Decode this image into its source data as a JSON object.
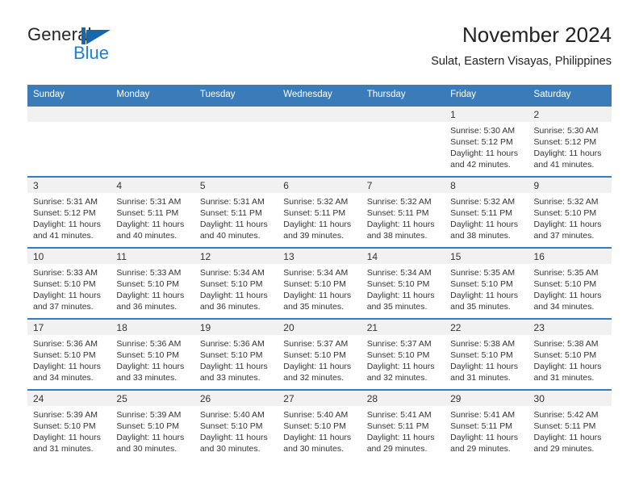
{
  "brand": {
    "name_part1": "General",
    "name_part2": "Blue",
    "mark_icon": "triangle-flag-icon"
  },
  "header": {
    "title": "November 2024",
    "subtitle": "Sulat, Eastern Visayas, Philippines"
  },
  "calendar": {
    "weekday_headers": [
      "Sunday",
      "Monday",
      "Tuesday",
      "Wednesday",
      "Thursday",
      "Friday",
      "Saturday"
    ],
    "accent_color": "#3b7cb8",
    "daynum_band_color": "#f1f1f1",
    "weeks": [
      [
        {
          "day": ""
        },
        {
          "day": ""
        },
        {
          "day": ""
        },
        {
          "day": ""
        },
        {
          "day": ""
        },
        {
          "day": "1",
          "sunrise": "Sunrise: 5:30 AM",
          "sunset": "Sunset: 5:12 PM",
          "daylight1": "Daylight: 11 hours",
          "daylight2": "and 42 minutes."
        },
        {
          "day": "2",
          "sunrise": "Sunrise: 5:30 AM",
          "sunset": "Sunset: 5:12 PM",
          "daylight1": "Daylight: 11 hours",
          "daylight2": "and 41 minutes."
        }
      ],
      [
        {
          "day": "3",
          "sunrise": "Sunrise: 5:31 AM",
          "sunset": "Sunset: 5:12 PM",
          "daylight1": "Daylight: 11 hours",
          "daylight2": "and 41 minutes."
        },
        {
          "day": "4",
          "sunrise": "Sunrise: 5:31 AM",
          "sunset": "Sunset: 5:11 PM",
          "daylight1": "Daylight: 11 hours",
          "daylight2": "and 40 minutes."
        },
        {
          "day": "5",
          "sunrise": "Sunrise: 5:31 AM",
          "sunset": "Sunset: 5:11 PM",
          "daylight1": "Daylight: 11 hours",
          "daylight2": "and 40 minutes."
        },
        {
          "day": "6",
          "sunrise": "Sunrise: 5:32 AM",
          "sunset": "Sunset: 5:11 PM",
          "daylight1": "Daylight: 11 hours",
          "daylight2": "and 39 minutes."
        },
        {
          "day": "7",
          "sunrise": "Sunrise: 5:32 AM",
          "sunset": "Sunset: 5:11 PM",
          "daylight1": "Daylight: 11 hours",
          "daylight2": "and 38 minutes."
        },
        {
          "day": "8",
          "sunrise": "Sunrise: 5:32 AM",
          "sunset": "Sunset: 5:11 PM",
          "daylight1": "Daylight: 11 hours",
          "daylight2": "and 38 minutes."
        },
        {
          "day": "9",
          "sunrise": "Sunrise: 5:32 AM",
          "sunset": "Sunset: 5:10 PM",
          "daylight1": "Daylight: 11 hours",
          "daylight2": "and 37 minutes."
        }
      ],
      [
        {
          "day": "10",
          "sunrise": "Sunrise: 5:33 AM",
          "sunset": "Sunset: 5:10 PM",
          "daylight1": "Daylight: 11 hours",
          "daylight2": "and 37 minutes."
        },
        {
          "day": "11",
          "sunrise": "Sunrise: 5:33 AM",
          "sunset": "Sunset: 5:10 PM",
          "daylight1": "Daylight: 11 hours",
          "daylight2": "and 36 minutes."
        },
        {
          "day": "12",
          "sunrise": "Sunrise: 5:34 AM",
          "sunset": "Sunset: 5:10 PM",
          "daylight1": "Daylight: 11 hours",
          "daylight2": "and 36 minutes."
        },
        {
          "day": "13",
          "sunrise": "Sunrise: 5:34 AM",
          "sunset": "Sunset: 5:10 PM",
          "daylight1": "Daylight: 11 hours",
          "daylight2": "and 35 minutes."
        },
        {
          "day": "14",
          "sunrise": "Sunrise: 5:34 AM",
          "sunset": "Sunset: 5:10 PM",
          "daylight1": "Daylight: 11 hours",
          "daylight2": "and 35 minutes."
        },
        {
          "day": "15",
          "sunrise": "Sunrise: 5:35 AM",
          "sunset": "Sunset: 5:10 PM",
          "daylight1": "Daylight: 11 hours",
          "daylight2": "and 35 minutes."
        },
        {
          "day": "16",
          "sunrise": "Sunrise: 5:35 AM",
          "sunset": "Sunset: 5:10 PM",
          "daylight1": "Daylight: 11 hours",
          "daylight2": "and 34 minutes."
        }
      ],
      [
        {
          "day": "17",
          "sunrise": "Sunrise: 5:36 AM",
          "sunset": "Sunset: 5:10 PM",
          "daylight1": "Daylight: 11 hours",
          "daylight2": "and 34 minutes."
        },
        {
          "day": "18",
          "sunrise": "Sunrise: 5:36 AM",
          "sunset": "Sunset: 5:10 PM",
          "daylight1": "Daylight: 11 hours",
          "daylight2": "and 33 minutes."
        },
        {
          "day": "19",
          "sunrise": "Sunrise: 5:36 AM",
          "sunset": "Sunset: 5:10 PM",
          "daylight1": "Daylight: 11 hours",
          "daylight2": "and 33 minutes."
        },
        {
          "day": "20",
          "sunrise": "Sunrise: 5:37 AM",
          "sunset": "Sunset: 5:10 PM",
          "daylight1": "Daylight: 11 hours",
          "daylight2": "and 32 minutes."
        },
        {
          "day": "21",
          "sunrise": "Sunrise: 5:37 AM",
          "sunset": "Sunset: 5:10 PM",
          "daylight1": "Daylight: 11 hours",
          "daylight2": "and 32 minutes."
        },
        {
          "day": "22",
          "sunrise": "Sunrise: 5:38 AM",
          "sunset": "Sunset: 5:10 PM",
          "daylight1": "Daylight: 11 hours",
          "daylight2": "and 31 minutes."
        },
        {
          "day": "23",
          "sunrise": "Sunrise: 5:38 AM",
          "sunset": "Sunset: 5:10 PM",
          "daylight1": "Daylight: 11 hours",
          "daylight2": "and 31 minutes."
        }
      ],
      [
        {
          "day": "24",
          "sunrise": "Sunrise: 5:39 AM",
          "sunset": "Sunset: 5:10 PM",
          "daylight1": "Daylight: 11 hours",
          "daylight2": "and 31 minutes."
        },
        {
          "day": "25",
          "sunrise": "Sunrise: 5:39 AM",
          "sunset": "Sunset: 5:10 PM",
          "daylight1": "Daylight: 11 hours",
          "daylight2": "and 30 minutes."
        },
        {
          "day": "26",
          "sunrise": "Sunrise: 5:40 AM",
          "sunset": "Sunset: 5:10 PM",
          "daylight1": "Daylight: 11 hours",
          "daylight2": "and 30 minutes."
        },
        {
          "day": "27",
          "sunrise": "Sunrise: 5:40 AM",
          "sunset": "Sunset: 5:10 PM",
          "daylight1": "Daylight: 11 hours",
          "daylight2": "and 30 minutes."
        },
        {
          "day": "28",
          "sunrise": "Sunrise: 5:41 AM",
          "sunset": "Sunset: 5:11 PM",
          "daylight1": "Daylight: 11 hours",
          "daylight2": "and 29 minutes."
        },
        {
          "day": "29",
          "sunrise": "Sunrise: 5:41 AM",
          "sunset": "Sunset: 5:11 PM",
          "daylight1": "Daylight: 11 hours",
          "daylight2": "and 29 minutes."
        },
        {
          "day": "30",
          "sunrise": "Sunrise: 5:42 AM",
          "sunset": "Sunset: 5:11 PM",
          "daylight1": "Daylight: 11 hours",
          "daylight2": "and 29 minutes."
        }
      ]
    ]
  }
}
